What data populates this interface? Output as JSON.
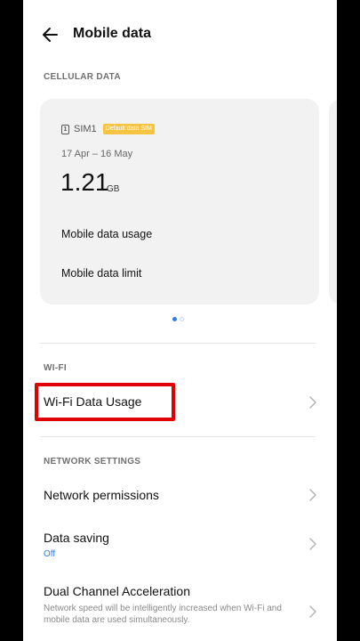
{
  "header": {
    "title": "Mobile data"
  },
  "cellular": {
    "section_label": "CELLULAR DATA",
    "sim_icon_text": "1",
    "sim_name": "SIM1",
    "sim_badge": "Default data SIM",
    "date_range": "17 Apr – 16 May",
    "usage_value": "1.21",
    "usage_unit": "GB",
    "usage_link": "Mobile data usage",
    "limit_link": "Mobile data limit",
    "carousel": {
      "pages": 2,
      "active_page": 1
    }
  },
  "wifi": {
    "section_label": "WI-FI",
    "data_usage_label": "Wi-Fi Data Usage"
  },
  "network": {
    "section_label": "NETWORK SETTINGS",
    "permissions_label": "Network permissions",
    "data_saving_label": "Data saving",
    "data_saving_value": "Off",
    "dual_channel_label": "Dual Channel Acceleration",
    "dual_channel_desc": "Network speed will be intelligently increased when Wi-Fi and mobile data are used simultaneously."
  },
  "colors": {
    "accent": "#2f7de1",
    "badge": "#f6c443",
    "highlight": "#e00000",
    "card_bg": "#f2f2f2"
  },
  "icons": [
    "back-arrow-icon",
    "sim-card-icon",
    "chevron-right-icon"
  ]
}
